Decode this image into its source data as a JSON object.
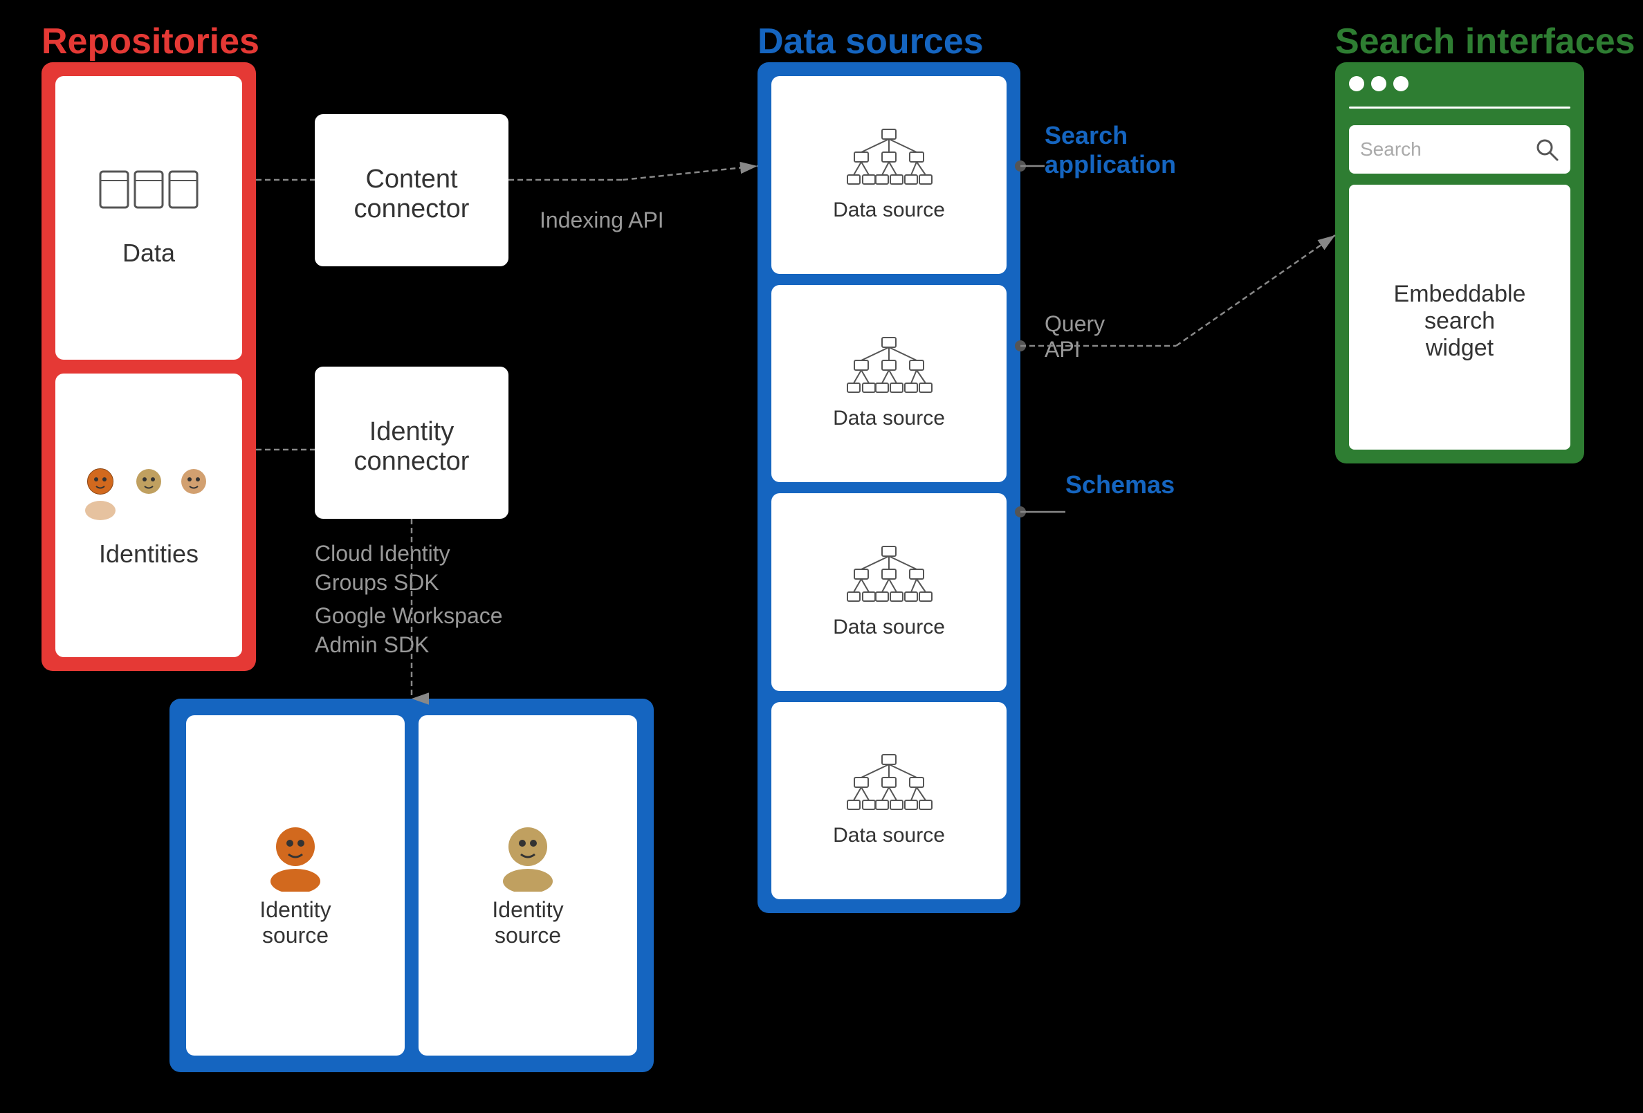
{
  "sections": {
    "repositories": {
      "title": "Repositories",
      "title_color": "#e53935",
      "data_card": {
        "label": "Data",
        "icon": "data-icon"
      },
      "identities_card": {
        "label": "Identities",
        "icon": "identities-icon"
      }
    },
    "connectors": {
      "content_connector": {
        "label": "Content\nconnector",
        "icon": "content-connector-icon"
      },
      "identity_connector": {
        "label": "Identity\nconnector",
        "icon": "identity-connector-icon"
      }
    },
    "data_sources": {
      "title": "Data sources",
      "title_color": "#1565c0",
      "cards": [
        {
          "label": "Data source",
          "icon": "network-icon"
        },
        {
          "label": "Data source",
          "icon": "network-icon"
        },
        {
          "label": "Data source",
          "icon": "network-icon"
        },
        {
          "label": "Data source",
          "icon": "network-icon"
        }
      ]
    },
    "identity_sources": {
      "cards": [
        {
          "label": "Identity\nsource",
          "icon": "person1-icon"
        },
        {
          "label": "Identity\nsource",
          "icon": "person2-icon"
        }
      ]
    },
    "search_interfaces": {
      "title": "Search interfaces",
      "title_color": "#2e7d32",
      "search_bar_placeholder": "Search",
      "widget_label": "Embeddable\nsearch\nwidget"
    }
  },
  "labels": {
    "indexing_api": "Indexing API",
    "cloud_identity": "Cloud Identity\nGroups SDK",
    "google_workspace": "Google Workspace\nAdmin SDK",
    "query_api": "Query\nAPI",
    "search_application": "Search\napplication",
    "schemas": "Schemas"
  }
}
